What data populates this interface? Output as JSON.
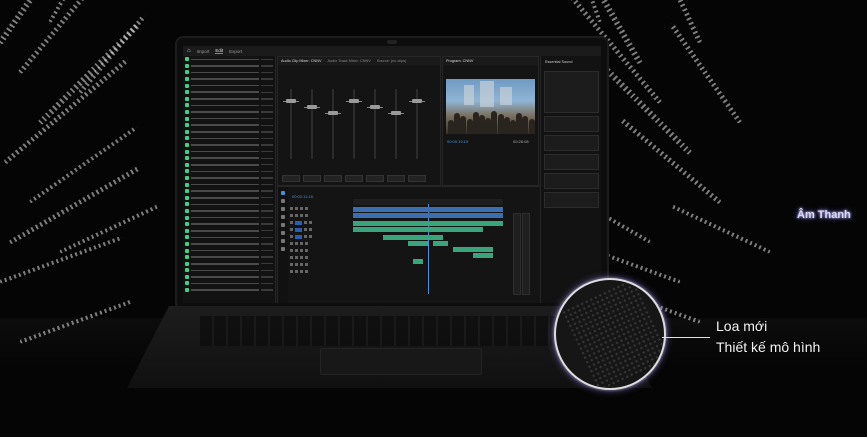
{
  "callouts": {
    "audio_feature": "Âm Thanh",
    "speaker_line1": "Loa mới",
    "speaker_line2": "Thiết kế mô hình"
  },
  "app": {
    "menu_items": [
      "Import",
      "Edit",
      "Export"
    ],
    "active_menu": "Edit",
    "panel_tabs": [
      "Audio Clip Mixer: CNNV",
      "Audio Track Mixer: CNNV",
      "Source: (no clips)"
    ],
    "program_tab": "Program: CNNV",
    "essential_title": "Essential Sound",
    "program_timecode": "00:00:19:19",
    "program_timecode_end": "00:26:08",
    "timeline_timecode": "00:02:11:18"
  },
  "colors": {
    "accent_blue": "#4a90d9",
    "clip_green": "#3aa57a",
    "clip_blue": "#3b6fb0",
    "glow_purple": "#7a6cff"
  }
}
